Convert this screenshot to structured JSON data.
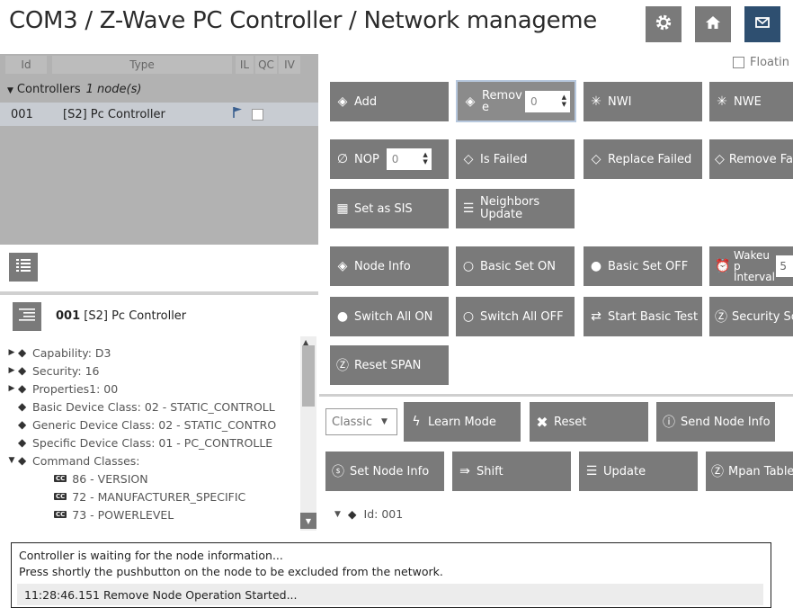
{
  "header": {
    "title": "COM3 / Z-Wave PC Controller / Network manageme",
    "buttons": [
      "settings",
      "home",
      "mail"
    ]
  },
  "node_table": {
    "columns": [
      "Id",
      "Type",
      "IL",
      "QC",
      "IV"
    ],
    "group_label": "Controllers",
    "group_count": "1 node(s)",
    "row": {
      "id": "001",
      "type": "[S2] Pc Controller"
    }
  },
  "details": {
    "header_id": "001",
    "header_name": "[S2] Pc Controller",
    "tree": [
      {
        "text": "Capability: D3",
        "toggle": "right"
      },
      {
        "text": "Security: 16",
        "toggle": "right"
      },
      {
        "text": "Properties1: 00",
        "toggle": "right"
      },
      {
        "text": "Basic Device Class: 02 - STATIC_CONTROLL",
        "toggle": ""
      },
      {
        "text": "Generic Device Class: 02 - STATIC_CONTRO",
        "toggle": ""
      },
      {
        "text": "Specific Device Class: 01 - PC_CONTROLLE",
        "toggle": ""
      },
      {
        "text": "Command Classes:",
        "toggle": "down"
      }
    ],
    "command_classes": [
      "86 - VERSION",
      "72 - MANUFACTURER_SPECIFIC",
      "73 - POWERLEVEL"
    ],
    "cc_badge": "CC"
  },
  "toolbar": {
    "floating_label": "Floatin",
    "add": "Add",
    "remove": "Remov e",
    "remove_value": "0",
    "nwi": "NWI",
    "nwe": "NWE",
    "nop": "NOP",
    "nop_value": "0",
    "is_failed": "Is Failed",
    "replace_failed": "Replace Failed",
    "remove_failed": "Remove Fa",
    "set_as_sis": "Set as SIS",
    "neighbors_update": "Neighbors Update",
    "node_info": "Node Info",
    "basic_set_on": "Basic Set ON",
    "basic_set_off": "Basic Set OFF",
    "wakeup_interval": "Wakeu p Interval",
    "wakeup_value": "5",
    "switch_all_on": "Switch All ON",
    "switch_all_off": "Switch All OFF",
    "start_basic_test": "Start Basic Test",
    "security_sc": "Security Sc",
    "reset_span": "Reset SPAN"
  },
  "controller": {
    "mode": "Classic",
    "learn_mode": "Learn Mode",
    "reset": "Reset",
    "send_node_info": "Send Node Info",
    "set_node_info": "Set Node Info",
    "shift": "Shift",
    "update": "Update",
    "mpan_table": "Mpan Table",
    "id_label": "Id: 001"
  },
  "log": {
    "line1": "Controller is waiting for the node information...",
    "line2": "Press shortly the pushbutton on the node to be excluded from the network.",
    "line3": "11:28:46.151 Remove Node Operation Started..."
  },
  "colors": {
    "button": "#7a7a7a",
    "active_header": "#2e4f70",
    "panel": "#b2b2b2",
    "selected_row": "#c8ccd2"
  }
}
